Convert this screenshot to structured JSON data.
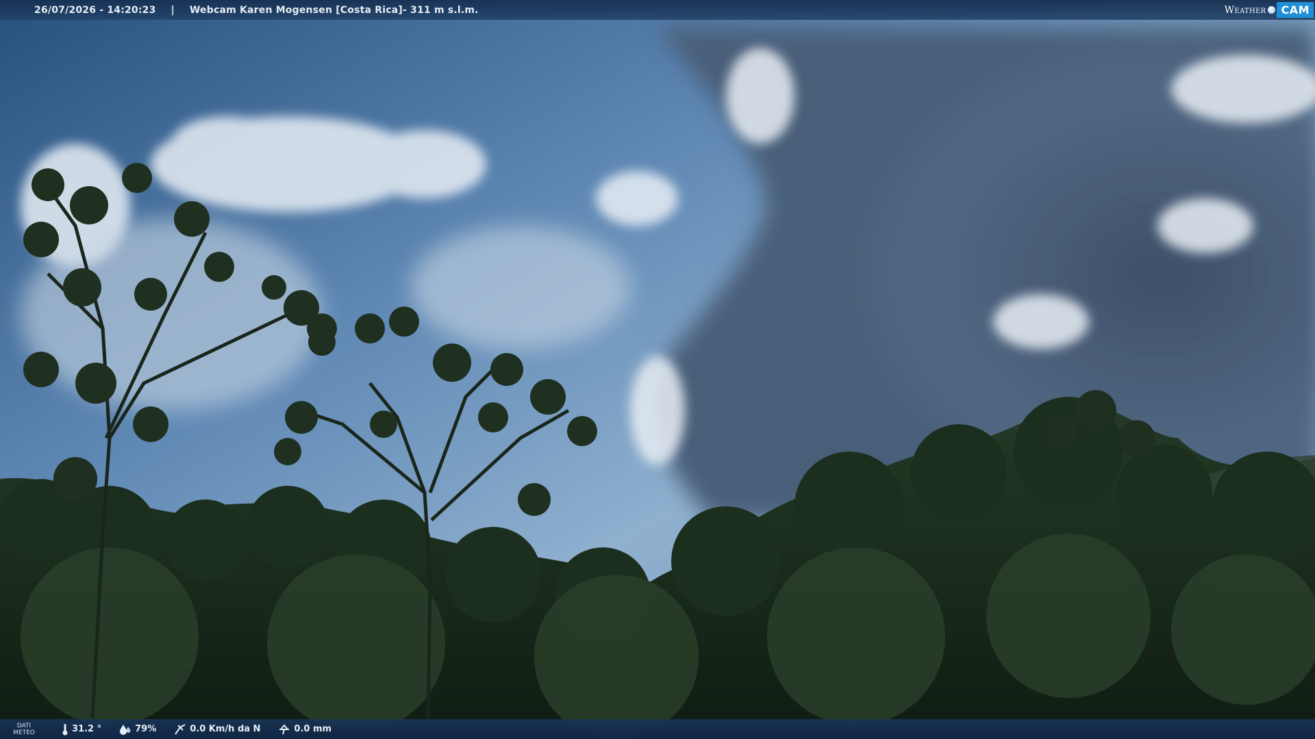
{
  "header": {
    "timestamp": "26/07/2026 - 14:20:23",
    "separator": "|",
    "title": "Webcam Karen Mogensen [Costa Rica]",
    "altitude": " - 311 m s.l.m."
  },
  "logo": {
    "weather": "Weather",
    "cam": "CAM"
  },
  "footer": {
    "label_line1": "DATI",
    "label_line2": "METEO",
    "temperature": "31.2 °",
    "humidity": "79%",
    "wind": "0.0 Km/h da N",
    "rain": "0.0 mm",
    "icons": [
      "thermometer-icon",
      "humidity-drop-icon",
      "wind-icon",
      "rain-gauge-icon"
    ]
  }
}
